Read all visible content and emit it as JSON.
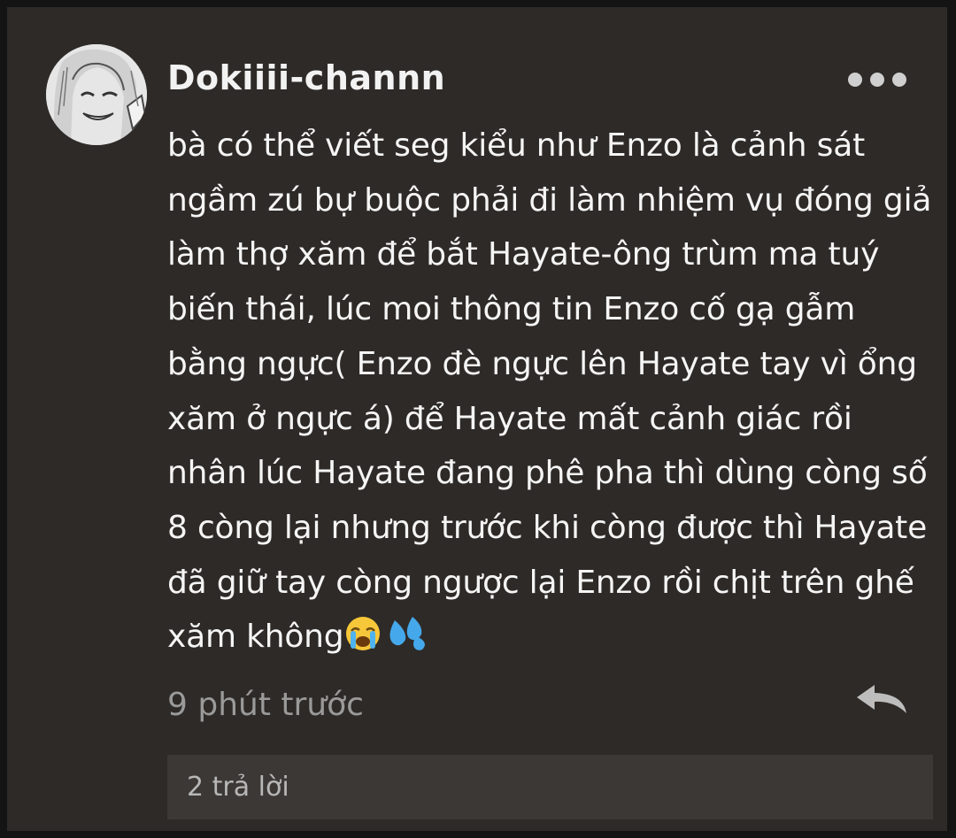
{
  "comment": {
    "username": "Dokiiii-channn",
    "text": "bà có thể viết seg kiểu như Enzo là cảnh sát ngầm zú bự buộc phải đi làm nhiệm vụ đóng giả làm thợ xăm để bắt Hayate-ông trùm ma tuý biến thái, lúc moi thông tin Enzo cố gạ gẫm bằng ngực( Enzo đè ngực lên Hayate tay vì ổng xăm ở ngực á) để Hayate mất cảnh giác rồi nhân lúc Hayate đang phê pha thì dùng còng số 8 còng lại nhưng trước khi còng được thì Hayate đã giữ tay còng ngược lại Enzo rồi chịt trên ghế xăm không",
    "emojis": [
      "crying-face-emoji",
      "sweat-droplets-emoji"
    ],
    "timestamp": "9 phút trước",
    "replies_label": "2 trả lời"
  },
  "colors": {
    "background": "#141414",
    "card": "#2e2a27",
    "replies_bar": "#3c3835",
    "text": "#f5f5f5",
    "muted": "#9a9a9a"
  },
  "icons": {
    "more": "more-dots-icon",
    "reply": "reply-arrow-icon"
  }
}
